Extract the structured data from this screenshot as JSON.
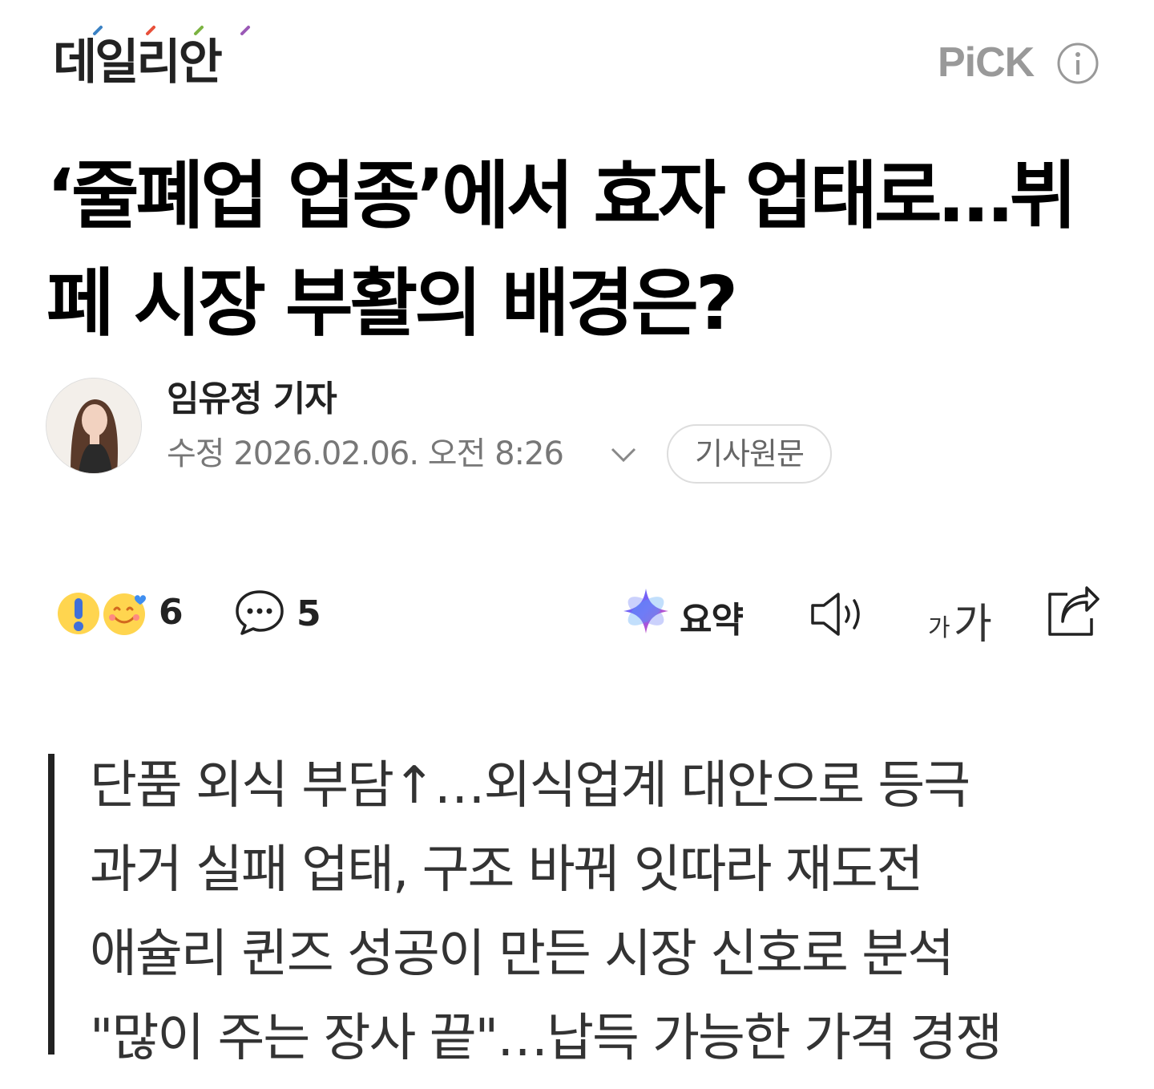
{
  "header": {
    "logo_text": "데일리안",
    "pick_label": "PiCK",
    "logo_dot_colors": [
      "#3b82c4",
      "#e8503a",
      "#7cb342",
      "#9b59b6"
    ]
  },
  "article": {
    "title": "‘줄폐업 업종’에서 효자 업태로…뷔페 시장 부활의 배경은?",
    "reporter": "임유정 기자",
    "date": "수정 2026.02.06. 오전 8:26",
    "original_button": "기사원문"
  },
  "toolbar": {
    "reaction_count": "6",
    "comment_count": "5",
    "summary_label": "요약",
    "fontsize_small": "가",
    "fontsize_big": "가"
  },
  "summary": {
    "lines": [
      "단품 외식 부담↑…외식업계 대안으로 등극",
      "과거 실패 업태, 구조 바꿔 잇따라 재도전",
      "애슐리 퀸즈 성공이 만든 시장 신호로 분석",
      "\"많이 주는 장사 끝\"…납득 가능한 가격 경쟁"
    ]
  },
  "icons": {
    "info": "info-icon",
    "chevron": "chevron-down-icon",
    "comment": "speech-bubble-icon",
    "summary": "ai-sparkle-icon",
    "audio": "speaker-icon",
    "share": "share-icon"
  }
}
